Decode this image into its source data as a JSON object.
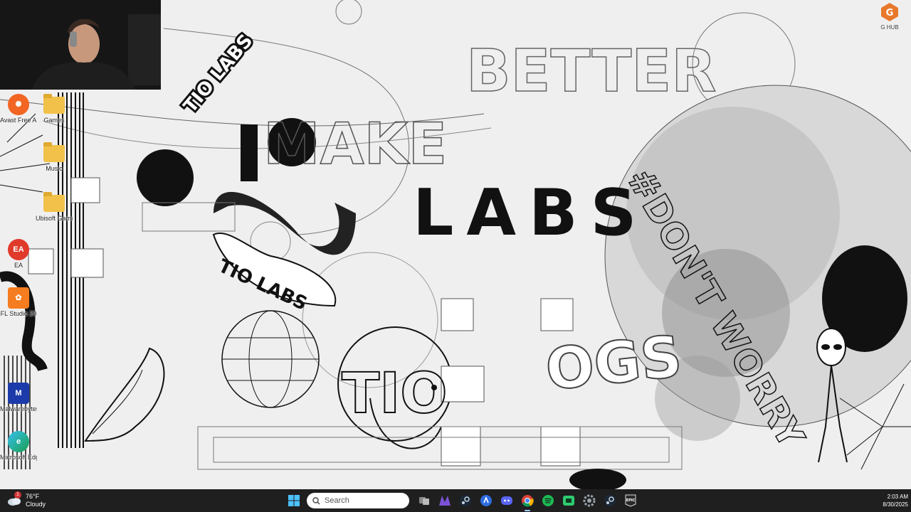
{
  "wallpaper": {
    "words": [
      "BETTER",
      "MAKE",
      "LABS",
      "#DON'T WORRY",
      "OGS",
      "TIO LABS",
      "TIO LABS",
      "TIO"
    ]
  },
  "desktop_icons": [
    {
      "label": "Avast Free Antivirus",
      "icon": "avast-icon"
    },
    {
      "label": "Games",
      "icon": "folder-icon"
    },
    {
      "label": "Music",
      "icon": "folder-icon"
    },
    {
      "label": "Ubisoft Game ...",
      "icon": "folder-icon"
    },
    {
      "label": "EA",
      "icon": "ea-icon"
    },
    {
      "label": "FL Studio 20",
      "icon": "fl-studio-icon"
    },
    {
      "label": "Malwarebytes",
      "icon": "malwarebytes-icon"
    },
    {
      "label": "Microsoft Edge",
      "icon": "edge-icon"
    }
  ],
  "corner_app": {
    "label": "G HUB",
    "icon": "ghub-icon"
  },
  "taskbar": {
    "weather": {
      "temp": "76°F",
      "condition": "Cloudy",
      "badge": "1"
    },
    "search_placeholder": "Search",
    "apps": [
      "start-icon",
      "search-icon",
      "task-view-icon",
      "notepad-icon",
      "steam-icon",
      "ea-app-icon",
      "discord-icon",
      "chrome-icon",
      "spotify-icon",
      "xbox-icon",
      "settings-icon",
      "steam-icon",
      "epic-games-icon"
    ],
    "clock": {
      "time": "2:03 AM",
      "date": "8/30/2025"
    }
  },
  "colors": {
    "taskbar": "#1f1f1f",
    "wallpaper_bg": "#efefef",
    "accent": "#0078d4"
  }
}
